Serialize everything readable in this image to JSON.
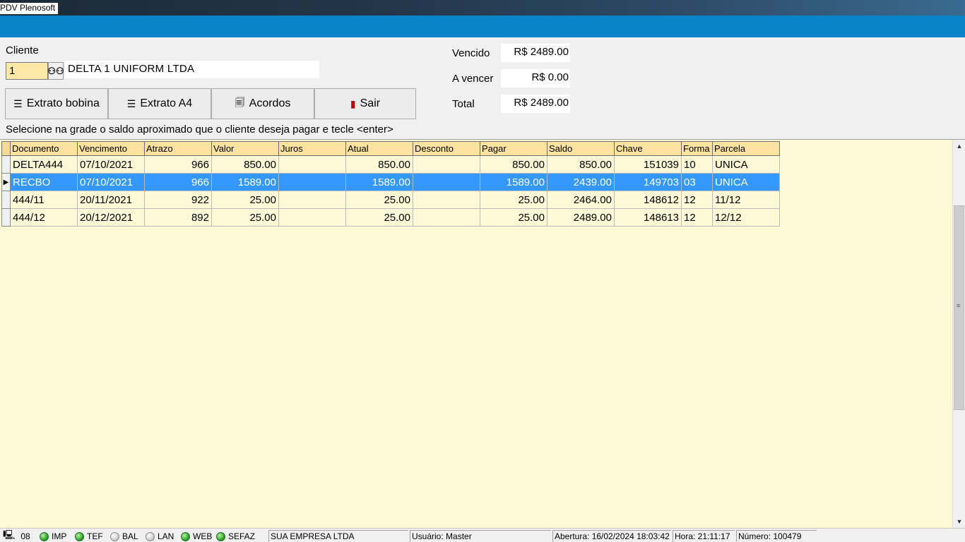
{
  "window": {
    "title": "PDV Plenosoft"
  },
  "cliente": {
    "label": "Cliente",
    "code": "1",
    "name": "DELTA 1 UNIFORM LTDA"
  },
  "buttons": {
    "extrato_bobina": "Extrato bobina",
    "extrato_a4": "Extrato A4",
    "acordos": "Acordos",
    "sair": "Sair"
  },
  "instruction": "Selecione na grade o saldo aproximado que o cliente deseja pagar e tecle <enter>",
  "totals": {
    "vencido_label": "Vencido",
    "vencido_value": "R$ 2489.00",
    "avencer_label": "A vencer",
    "avencer_value": "R$ 0.00",
    "total_label": "Total",
    "total_value": "R$ 2489.00"
  },
  "grid": {
    "columns": [
      "Documento",
      "Vencimento",
      "Atrazo",
      "Valor",
      "Juros",
      "Atual",
      "Desconto",
      "Pagar",
      "Saldo",
      "Chave",
      "Forma",
      "Parcela"
    ],
    "rows": [
      [
        "DELTA444",
        "07/10/2021",
        "966",
        "850.00",
        "",
        "850.00",
        "",
        "850.00",
        "850.00",
        "151039",
        "10",
        "UNICA"
      ],
      [
        "RECBO",
        "07/10/2021",
        "966",
        "1589.00",
        "",
        "1589.00",
        "",
        "1589.00",
        "2439.00",
        "149703",
        "03",
        "UNICA"
      ],
      [
        "444/11",
        "20/11/2021",
        "922",
        "25.00",
        "",
        "25.00",
        "",
        "25.00",
        "2464.00",
        "148612",
        "12",
        "11/12"
      ],
      [
        "444/12",
        "20/12/2021",
        "892",
        "25.00",
        "",
        "25.00",
        "",
        "25.00",
        "2489.00",
        "148613",
        "12",
        "12/12"
      ]
    ],
    "selected_row": 1
  },
  "status": {
    "terminal": "08",
    "indicators": [
      {
        "label": "IMP",
        "on": true
      },
      {
        "label": "TEF",
        "on": true
      },
      {
        "label": "BAL",
        "on": false
      },
      {
        "label": "LAN",
        "on": false
      },
      {
        "label": "WEB",
        "on": true
      },
      {
        "label": "SEFAZ",
        "on": true
      }
    ],
    "empresa": "SUA EMPRESA LTDA",
    "usuario": "Usuário: Master",
    "abertura": "Abertura: 16/02/2024 18:03:42",
    "hora": "Hora: 21:11:17",
    "numero": "Número: 100479"
  },
  "colors": {
    "accent_bar": "#0a83c9",
    "selection": "#3399ff",
    "grid_bg": "#fdf9d6",
    "header_bg": "#fde2a0",
    "code_field": "#ffe8a8"
  }
}
